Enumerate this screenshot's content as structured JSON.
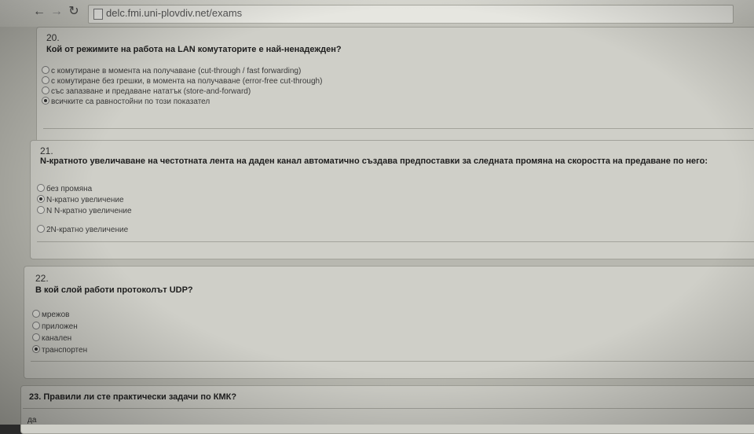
{
  "browser": {
    "url": "delc.fmi.uni-plovdiv.net/exams",
    "back_icon": "arrow-left-icon",
    "forward_icon": "arrow-right-icon",
    "reload_icon": "reload-icon"
  },
  "questions": [
    {
      "number": "20.",
      "text": "Кой от режимите на работа на LAN комутаторите е най-ненадежден?",
      "options": [
        {
          "label": "с комутиране в момента на получаване (cut-through / fast forwarding)",
          "checked": false
        },
        {
          "label": "с комутиране без грешки, в момента на получаване (error-free cut-through)",
          "checked": false
        },
        {
          "label": "със запазване и предаване нататък (store-and-forward)",
          "checked": false
        },
        {
          "label": "всичките са равностойни по този показател",
          "checked": true
        }
      ]
    },
    {
      "number": "21.",
      "text": "N-кратното увеличаване на честотната лента на даден канал автоматично създава предпоставки за следната промяна на скоростта на предаване по него:",
      "options": [
        {
          "label": "без промяна",
          "checked": false
        },
        {
          "label": "N-кратно увеличение",
          "checked": true
        },
        {
          "label": "N N-кратно увеличение",
          "checked": false
        },
        {
          "label": "2N-кратно увеличение",
          "checked": false
        }
      ]
    },
    {
      "number": "22.",
      "text": "В кой слой работи протоколът UDP?",
      "options": [
        {
          "label": "мрежов",
          "checked": false
        },
        {
          "label": "приложен",
          "checked": false
        },
        {
          "label": "канален",
          "checked": false
        },
        {
          "label": "транспортен",
          "checked": true
        }
      ]
    }
  ],
  "question23": {
    "title": "23. Правили ли сте практически задачи по КМК?",
    "answer": "да"
  }
}
